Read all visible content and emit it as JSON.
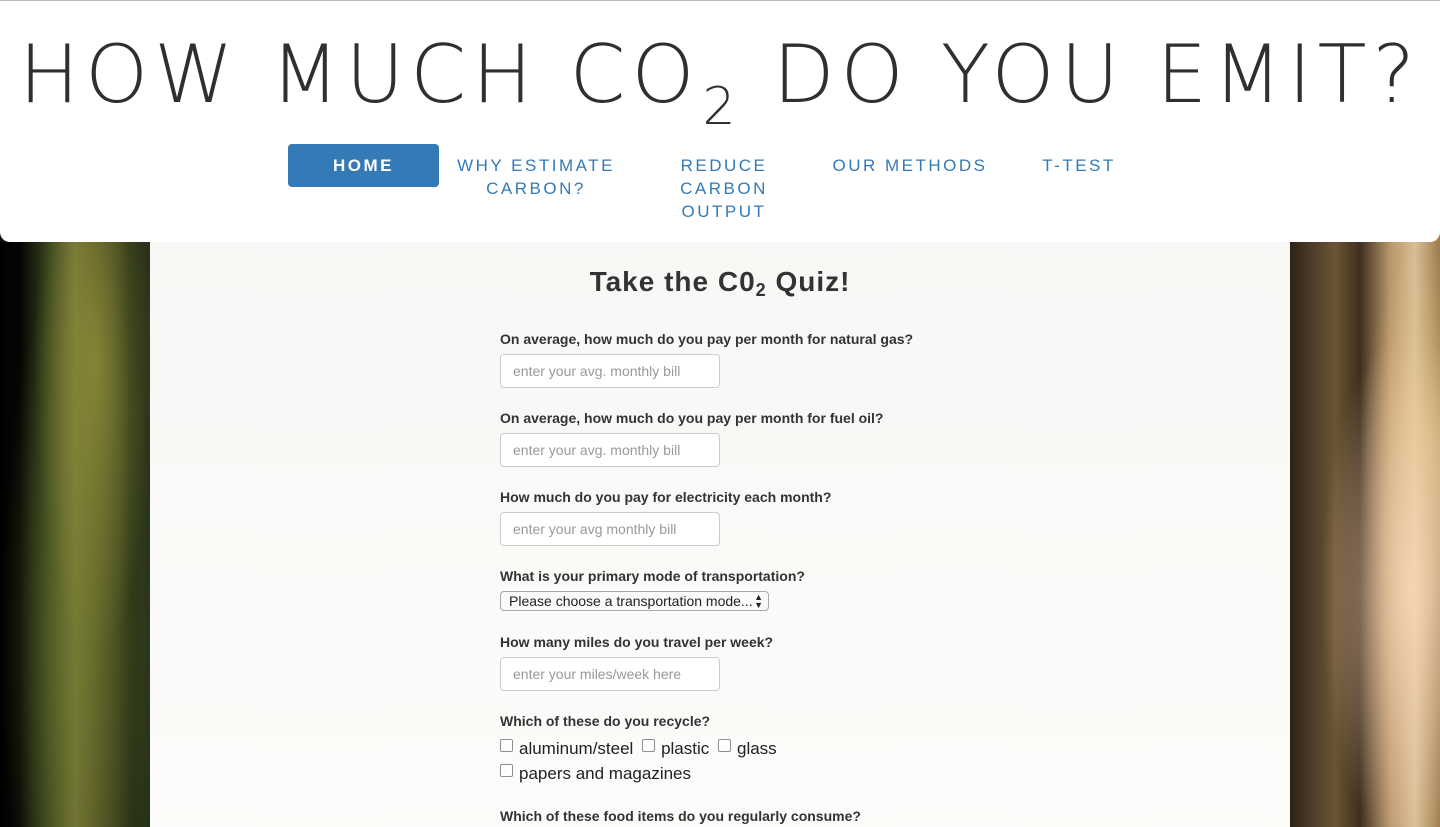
{
  "header": {
    "title_main": "HOW MUCH CO",
    "title_sub": "2",
    "title_end": " DO YOU EMIT?"
  },
  "nav": {
    "items": [
      {
        "label": "HOME",
        "active": true
      },
      {
        "label": "WHY ESTIMATE CARBON?"
      },
      {
        "label": "REDUCE CARBON OUTPUT"
      },
      {
        "label": "OUR METHODS"
      },
      {
        "label": "T-TEST"
      }
    ],
    "accent_color": "#337ab7"
  },
  "quiz": {
    "title_main": "Take the C0",
    "title_sub": "2",
    "title_end": " Quiz!",
    "questions": [
      {
        "label": "On average, how much do you pay per month for natural gas?",
        "placeholder": "enter your avg. monthly bill",
        "value": ""
      },
      {
        "label": "On average, how much do you pay per month for fuel oil?",
        "placeholder": "enter your avg. monthly bill",
        "value": ""
      },
      {
        "label": "How much do you pay for electricity each month?",
        "placeholder": "enter your avg monthly bill",
        "value": ""
      },
      {
        "label": "What is your primary mode of transportation?",
        "selected": "Please choose a transportation mode..."
      },
      {
        "label": "How many miles do you travel per week?",
        "placeholder": "enter your miles/week here",
        "value": ""
      },
      {
        "label": "Which of these do you recycle?",
        "options": [
          "aluminum/steel",
          "plastic",
          "glass",
          "papers and magazines"
        ]
      },
      {
        "label": "Which of these food items do you regularly consume?"
      }
    ]
  }
}
